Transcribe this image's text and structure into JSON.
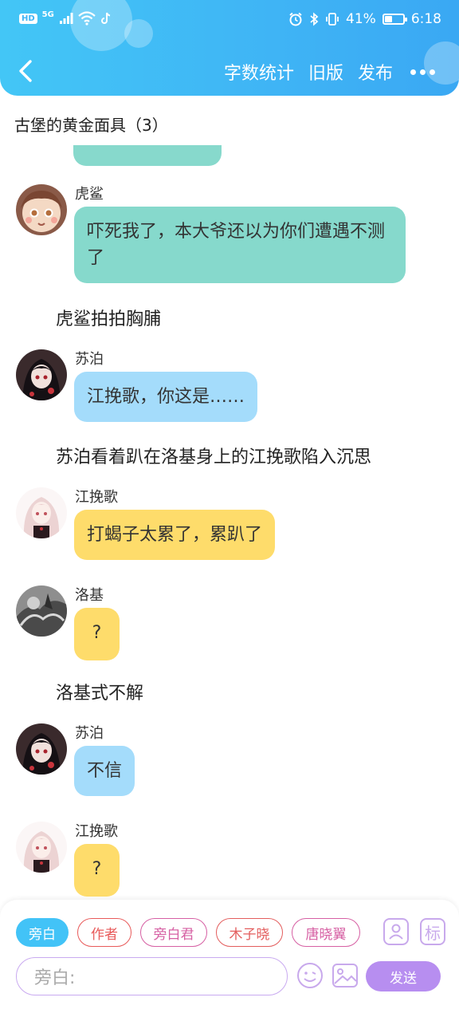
{
  "status_bar": {
    "hd": "HD",
    "network": "5G",
    "battery": "41%",
    "battery_level": 0.41,
    "time": "6:18"
  },
  "nav": {
    "word_count": "字数统计",
    "old_version": "旧版",
    "publish": "发布"
  },
  "story": {
    "title": "古堡的黄金面具（3）"
  },
  "messages": [
    {
      "speaker": "虎鲨",
      "text": "吓死我了，本大爷还以为你们遭遇不测了",
      "color": "#86d9cc"
    },
    {
      "narration": "虎鲨拍拍胸脯"
    },
    {
      "speaker": "苏泊",
      "text": "江挽歌，你这是……",
      "color": "#a4dcfb"
    },
    {
      "narration": "苏泊看着趴在洛基身上的江挽歌陷入沉思"
    },
    {
      "speaker": "江挽歌",
      "text": "打蝎子太累了，累趴了",
      "color": "#fedc6b"
    },
    {
      "speaker": "洛基",
      "text": "?",
      "color": "#fedc6b"
    },
    {
      "narration": "洛基式不解"
    },
    {
      "speaker": "苏泊",
      "text": "不信",
      "color": "#a4dcfb"
    },
    {
      "speaker": "江挽歌",
      "text": "?",
      "color": "#fedc6b"
    }
  ],
  "composer": {
    "roles": [
      "旁白",
      "作者",
      "旁白君",
      "木子晓",
      "唐晓翼"
    ],
    "mark_label": "标",
    "placeholder": "旁白:",
    "send": "发送"
  },
  "colors": {
    "header_accent": "#3fb4f5",
    "teal_bubble": "#86d9cc",
    "blue_bubble": "#a4dcfb",
    "yellow_bubble": "#fedc6b",
    "send_button": "#b78ef0"
  }
}
